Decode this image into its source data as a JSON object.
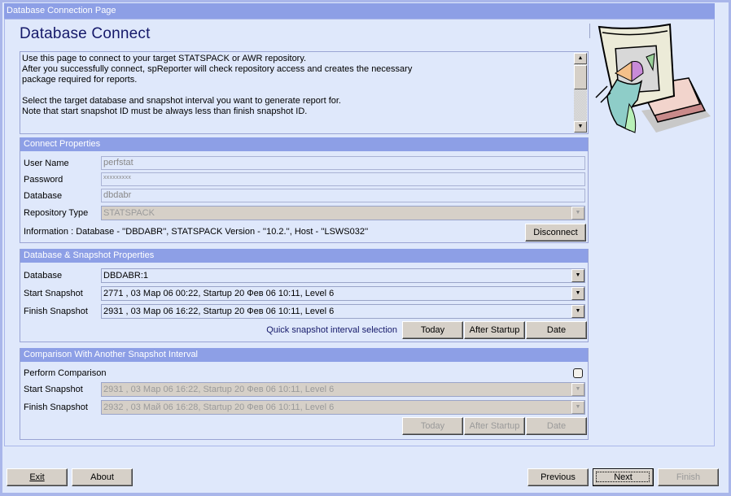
{
  "window": {
    "title": "Database Connection Page"
  },
  "page": {
    "title": "Database Connect",
    "description": "Use this page to connect to your target STATSPACK or AWR repository.\nAfter you successfully connect, spReporter will check repository access and creates the necessary\npackage required for reports.\n\nSelect the target database and snapshot interval you want to generate report for.\nNote that start snapshot ID must be always less than finish snapshot ID.",
    "illustration": "presentation-clipart"
  },
  "connect": {
    "header": "Connect Properties",
    "user_name_label": "User Name",
    "user_name_value": "perfstat",
    "password_label": "Password",
    "password_value": "xxxxxxxxx",
    "database_label": "Database",
    "database_value": "dbdabr",
    "repo_type_label": "Repository Type",
    "repo_type_value": "STATSPACK",
    "info": "Information : Database - ''DBDABR'', STATSPACK Version - ''10.2.'', Host - ''LSWS032''",
    "disconnect_label": "Disconnect"
  },
  "snapshot": {
    "header": "Database & Snapshot Properties",
    "database_label": "Database",
    "database_value": "DBDABR:1",
    "start_label": "Start Snapshot",
    "start_value": "2771 , 03 Мар 06 00:22, Startup 20 Фев 06 10:11, Level 6",
    "finish_label": "Finish Snapshot",
    "finish_value": "2931 , 03 Мар 06 16:22, Startup 20 Фев 06 10:11, Level 6",
    "quick_label": "Quick snapshot interval selection",
    "today_label": "Today",
    "after_startup_label": "After Startup",
    "date_label": "Date"
  },
  "comparison": {
    "header": "Comparison With Another Snapshot Interval",
    "perform_label": "Perform Comparison",
    "perform_checked": false,
    "start_label": "Start Snapshot",
    "start_value": "2931 , 03 Мар 06 16:22, Startup 20 Фев 06 10:11, Level 6",
    "finish_label": "Finish Snapshot",
    "finish_value": "2932 , 03 Май 06 16:28, Startup 20 Фев 06 10:11, Level 6",
    "today_label": "Today",
    "after_startup_label": "After Startup",
    "date_label": "Date"
  },
  "footer": {
    "exit_label": "Exit",
    "about_label": "About",
    "previous_label": "Previous",
    "next_label": "Next",
    "finish_label": "Finish"
  }
}
